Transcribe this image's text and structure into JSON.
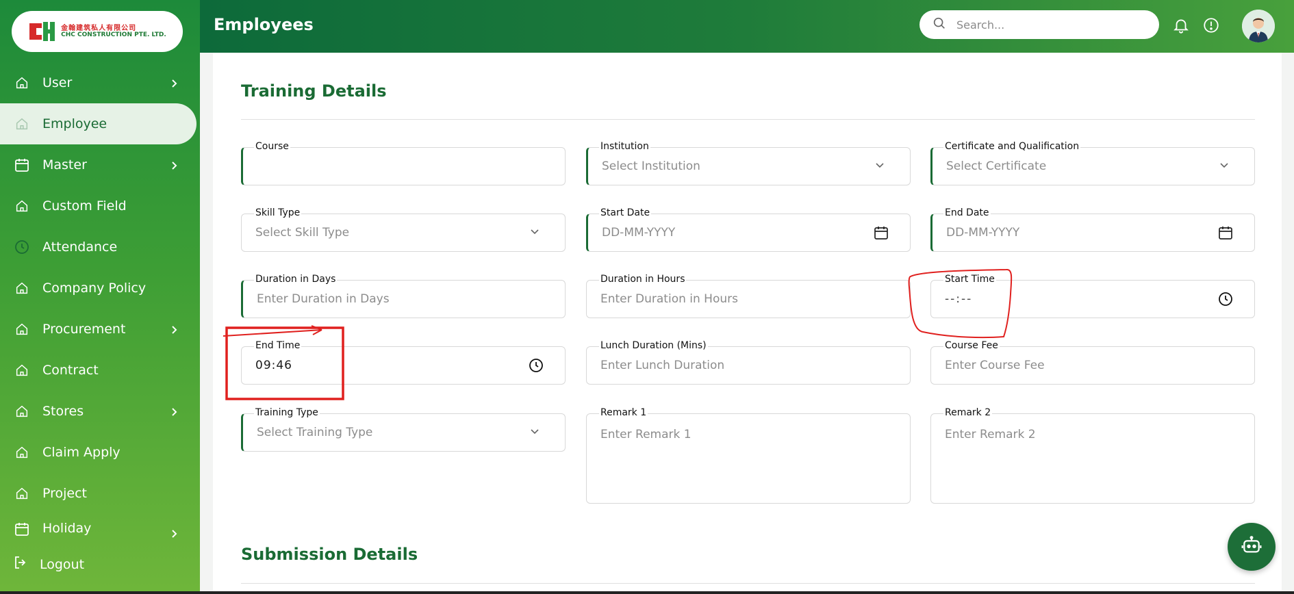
{
  "brand": {
    "cn_name": "金翰建筑私人有限公司",
    "en_name": "CHC CONSTRUCTION PTE. LTD."
  },
  "sidebar": {
    "items": [
      {
        "label": "User",
        "icon": "home-icon",
        "has_children": true
      },
      {
        "label": "Employee",
        "icon": "home-icon",
        "has_children": false,
        "active": true
      },
      {
        "label": "Master",
        "icon": "calendar-icon",
        "has_children": true
      },
      {
        "label": "Custom Field",
        "icon": "home-icon",
        "has_children": false
      },
      {
        "label": "Attendance",
        "icon": "clock-icon",
        "has_children": false
      },
      {
        "label": "Company Policy",
        "icon": "home-icon",
        "has_children": false
      },
      {
        "label": "Procurement",
        "icon": "home-icon",
        "has_children": true
      },
      {
        "label": "Contract",
        "icon": "home-icon",
        "has_children": false
      },
      {
        "label": "Stores",
        "icon": "home-icon",
        "has_children": true
      },
      {
        "label": "Claim Apply",
        "icon": "home-icon",
        "has_children": false
      },
      {
        "label": "Project",
        "icon": "home-icon",
        "has_children": false
      },
      {
        "label": "Holiday",
        "icon": "calendar-icon",
        "has_children": true
      }
    ],
    "logout_label": "Logout"
  },
  "header": {
    "title": "Employees",
    "search_placeholder": "Search..."
  },
  "training": {
    "title": "Training Details",
    "course": {
      "label": "Course",
      "value": ""
    },
    "institution": {
      "label": "Institution",
      "placeholder": "Select Institution"
    },
    "certificate": {
      "label": "Certificate and Qualification",
      "placeholder": "Select Certificate"
    },
    "skill_type": {
      "label": "Skill Type",
      "placeholder": "Select Skill Type"
    },
    "start_date": {
      "label": "Start Date",
      "placeholder": "DD-MM-YYYY"
    },
    "end_date": {
      "label": "End Date",
      "placeholder": "DD-MM-YYYY"
    },
    "duration_days": {
      "label": "Duration in Days",
      "placeholder": "Enter Duration in Days"
    },
    "duration_hours": {
      "label": "Duration in Hours",
      "placeholder": "Enter Duration in Hours"
    },
    "start_time": {
      "label": "Start Time",
      "placeholder": "--:--"
    },
    "end_time": {
      "label": "End Time",
      "value": "09:46"
    },
    "lunch_duration": {
      "label": "Lunch Duration (Mins)",
      "placeholder": "Enter Lunch Duration"
    },
    "course_fee": {
      "label": "Course Fee",
      "placeholder": "Enter Course Fee"
    },
    "training_type": {
      "label": "Training Type",
      "placeholder": "Select Training Type"
    },
    "remark1": {
      "label": "Remark 1",
      "placeholder": "Enter Remark 1"
    },
    "remark2": {
      "label": "Remark 2",
      "placeholder": "Enter Remark 2"
    }
  },
  "submission": {
    "title": "Submission Details"
  },
  "colors": {
    "primary": "#1a6b34",
    "annotation": "#e0201e"
  }
}
